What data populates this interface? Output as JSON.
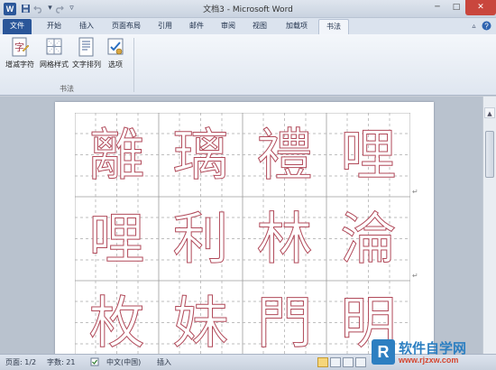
{
  "window": {
    "title": "文档3 - Microsoft Word",
    "minimize": "─",
    "maximize": "□",
    "close": "✕"
  },
  "quick_access": {
    "app_icon": "W",
    "items": [
      "save-icon",
      "undo-icon",
      "redo-icon",
      "customize-icon"
    ]
  },
  "tabs": [
    {
      "label": "文件"
    },
    {
      "label": "开始"
    },
    {
      "label": "插入"
    },
    {
      "label": "页面布局"
    },
    {
      "label": "引用"
    },
    {
      "label": "邮件"
    },
    {
      "label": "审阅"
    },
    {
      "label": "视图"
    },
    {
      "label": "加载项"
    },
    {
      "label": "书法"
    }
  ],
  "active_tab": "书法",
  "ribbon": {
    "group_label": "书法",
    "buttons": [
      {
        "label": "增减字符",
        "icon": "add-remove-chars-icon"
      },
      {
        "label": "网格样式",
        "icon": "grid-style-icon"
      },
      {
        "label": "文字排列",
        "icon": "text-arrange-icon"
      },
      {
        "label": "选项",
        "icon": "options-icon"
      }
    ]
  },
  "document": {
    "characters": [
      "離",
      "璃",
      "禮",
      "哩",
      "哩",
      "利",
      "林",
      "淪",
      "枚",
      "妹",
      "門",
      "明"
    ],
    "grid_color": "#b14a5a"
  },
  "statusbar": {
    "page": "页面: 1/2",
    "words": "字数: 21",
    "language": "中文(中国)",
    "mode": "插入"
  },
  "watermark": {
    "logo": "R",
    "name": "软件自学网",
    "url": "www.rjzxw.com"
  }
}
